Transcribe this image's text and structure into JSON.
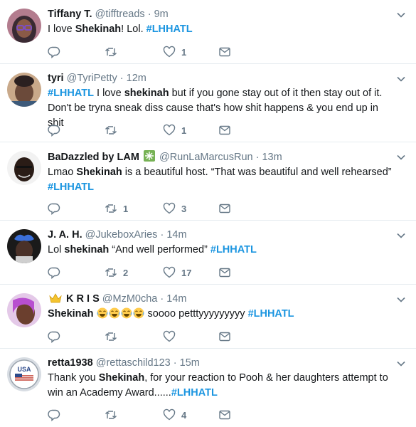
{
  "tweets": [
    {
      "name": "Tiffany T.",
      "handle": "@tifftreads",
      "time": "9m",
      "segments": [
        {
          "t": "I love ",
          "s": "text"
        },
        {
          "t": "Shekinah",
          "s": "bold"
        },
        {
          "t": "! Lol. ",
          "s": "text"
        },
        {
          "t": "#LHHATL",
          "s": "tag"
        }
      ],
      "replies": "",
      "retweets": "",
      "likes": "1"
    },
    {
      "name": "tyri",
      "handle": "@TyriPetty",
      "time": "12m",
      "segments": [
        {
          "t": "#LHHATL",
          "s": "tag"
        },
        {
          "t": " I love ",
          "s": "text"
        },
        {
          "t": "shekinah",
          "s": "bold"
        },
        {
          "t": " but if you gone stay out of it then stay out of it. Don't be tryna sneak diss cause that's how shit happens & you end up in shit",
          "s": "text"
        }
      ],
      "replies": "",
      "retweets": "",
      "likes": "1"
    },
    {
      "name": "BaDazzled by LAM",
      "handle": "@RunLaMarcusRun",
      "time": "13m",
      "badge": "sparkle-emoji",
      "segments": [
        {
          "t": "Lmao ",
          "s": "text"
        },
        {
          "t": "Shekinah",
          "s": "bold"
        },
        {
          "t": " is a beautiful host. “That was beautiful and well rehearsed” ",
          "s": "text"
        },
        {
          "t": "#LHHATL",
          "s": "tag"
        }
      ],
      "replies": "",
      "retweets": "1",
      "likes": "3"
    },
    {
      "name": "J. A. H.",
      "handle": "@JukeboxAries",
      "time": "14m",
      "segments": [
        {
          "t": "Lol ",
          "s": "text"
        },
        {
          "t": "shekinah",
          "s": "bold"
        },
        {
          "t": " “And well performed” ",
          "s": "text"
        },
        {
          "t": "#LHHATL",
          "s": "tag"
        }
      ],
      "replies": "",
      "retweets": "2",
      "likes": "17"
    },
    {
      "name": "K R I S",
      "handle": "@MzM0cha",
      "time": "14m",
      "badge": "crown-emoji",
      "segments": [
        {
          "t": "Shekinah",
          "s": "bold"
        },
        {
          "t": " ",
          "s": "text"
        },
        {
          "t": "tears-of-joy-emoji",
          "s": "emoji"
        },
        {
          "t": "tears-of-joy-emoji",
          "s": "emoji"
        },
        {
          "t": "tears-of-joy-emoji",
          "s": "emoji"
        },
        {
          "t": "tears-of-joy-emoji",
          "s": "emoji"
        },
        {
          "t": " soooo petttyyyyyyyyy ",
          "s": "text"
        },
        {
          "t": "#LHHATL",
          "s": "tag"
        }
      ],
      "replies": "",
      "retweets": "",
      "likes": ""
    },
    {
      "name": "retta1938",
      "handle": "@rettaschild123",
      "time": "15m",
      "segments": [
        {
          "t": "Thank you ",
          "s": "text"
        },
        {
          "t": "Shekinah",
          "s": "bold"
        },
        {
          "t": ", for your reaction to Pooh & her daughters attempt to win an Academy Award......",
          "s": "text"
        },
        {
          "t": "#LHHATL",
          "s": "tag"
        }
      ],
      "replies": "",
      "retweets": "",
      "likes": "4"
    }
  ],
  "avatar_labels": {
    "usa": "USA"
  },
  "colors": {
    "accent": "#1b95e0",
    "muted": "#657786",
    "divider": "#e6ecf0"
  }
}
